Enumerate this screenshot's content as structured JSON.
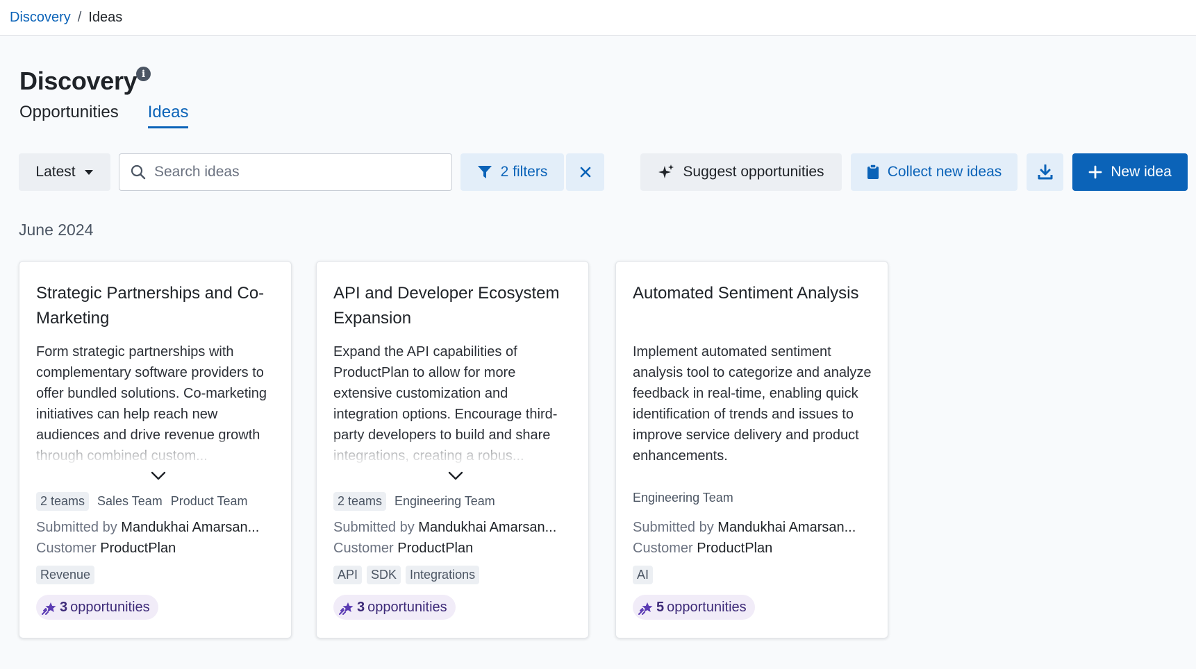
{
  "breadcrumb": {
    "parent": "Discovery",
    "separator": "/",
    "current": "Ideas"
  },
  "page": {
    "title": "Discovery"
  },
  "tabs": [
    {
      "label": "Opportunities",
      "active": false
    },
    {
      "label": "Ideas",
      "active": true
    }
  ],
  "toolbar": {
    "sort_label": "Latest",
    "search_placeholder": "Search ideas",
    "filters_label": "2 filters",
    "suggest_label": "Suggest opportunities",
    "collect_label": "Collect new ideas",
    "new_idea_label": "New idea"
  },
  "group": {
    "label": "June 2024"
  },
  "cards": [
    {
      "title": "Strategic Partnerships and Co-Marketing",
      "description": "Form strategic partnerships with complementary software providers to offer bundled solutions. Co-marketing initiatives can help reach new audiences and drive revenue growth through combined custom...",
      "teams_count": "2 teams",
      "teams": [
        "Sales Team",
        "Product Team"
      ],
      "submitted_label": "Submitted by",
      "submitted_by": "Mandukhai Amarsan...",
      "customer_label": "Customer",
      "customer": "ProductPlan",
      "tags": [
        "Revenue"
      ],
      "opportunity_count": "3",
      "opportunity_label": "opportunities"
    },
    {
      "title": "API and Developer Ecosystem Expansion",
      "description": "Expand the API capabilities of ProductPlan to allow for more extensive customization and integration options. Encourage third-party developers to build and share integrations, creating a robus...",
      "teams_count": "2 teams",
      "teams": [
        "Engineering Team"
      ],
      "submitted_label": "Submitted by",
      "submitted_by": "Mandukhai Amarsan...",
      "customer_label": "Customer",
      "customer": "ProductPlan",
      "tags": [
        "API",
        "SDK",
        "Integrations"
      ],
      "opportunity_count": "3",
      "opportunity_label": "opportunities"
    },
    {
      "title": "Automated Sentiment Analysis",
      "description": "Implement automated sentiment analysis tool to categorize and analyze feedback in real-time, enabling quick identification of trends and issues to improve service delivery and product enhancements.",
      "teams": [
        "Engineering Team"
      ],
      "submitted_label": "Submitted by",
      "submitted_by": "Mandukhai Amarsan...",
      "customer_label": "Customer",
      "customer": "ProductPlan",
      "tags": [
        "AI"
      ],
      "opportunity_count": "5",
      "opportunity_label": "opportunities"
    }
  ],
  "colors": {
    "accent": "#0b63b8",
    "opportunity_pill_bg": "#f1ecf8",
    "opportunity_icon": "#5b3bb3"
  }
}
